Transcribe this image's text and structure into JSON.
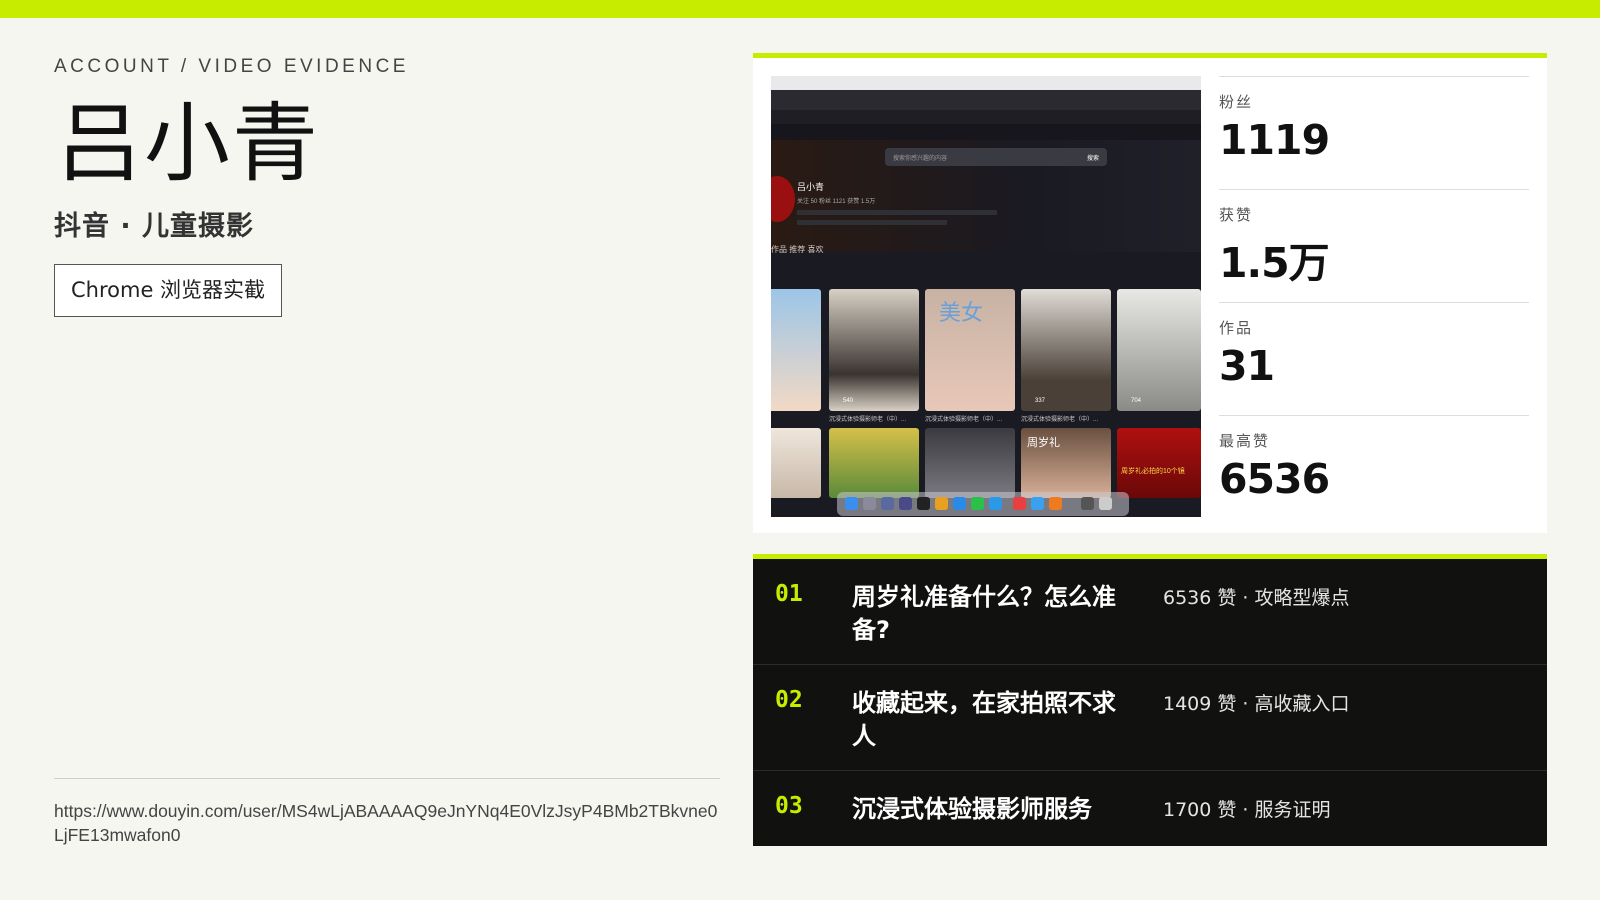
{
  "header": {
    "eyebrow": "ACCOUNT / VIDEO EVIDENCE",
    "title": "吕小青",
    "subtitle": "抖音 · 儿童摄影",
    "badge": "Chrome 浏览器实截"
  },
  "url": "https://www.douyin.com/user/MS4wLjABAAAAQ9eJnYNq4E0VlzJsyP4BMb2TBkvne0LjFE13mwafon0",
  "stats": [
    {
      "label": "粉丝",
      "value": "1119"
    },
    {
      "label": "获赞",
      "value": "1.5万"
    },
    {
      "label": "作品",
      "value": "31"
    },
    {
      "label": "最高赞",
      "value": "6536"
    }
  ],
  "videos": [
    {
      "num": "01",
      "title": "周岁礼准备什么？怎么准备?",
      "meta": "6536 赞 · 攻略型爆点"
    },
    {
      "num": "02",
      "title": "收藏起来，在家拍照不求人",
      "meta": "1409 赞 · 高收藏入口"
    },
    {
      "num": "03",
      "title": "沉浸式体验摄影师服务",
      "meta": "1700 赞 · 服务证明"
    }
  ],
  "screenshot": {
    "profile_name": "吕小青",
    "profile_stats": "关注 50   粉丝 1121   获赞 1.5万",
    "search_placeholder": "搜索你感兴趣的内容",
    "search_button": "搜索",
    "tabs": "作品   推荐   喜欢",
    "thumb_labels": {
      "girl": "美女",
      "birthday": "周岁礼",
      "banner": "周岁礼必拍的10个镜"
    },
    "thumb_counts": [
      "540",
      "337",
      "704"
    ],
    "thumb_caption": "沉浸式体验摄影师老（中）..."
  },
  "colors": {
    "accent": "#c8ec00",
    "dark_panel": "#111210",
    "background": "#f6f6f1"
  }
}
